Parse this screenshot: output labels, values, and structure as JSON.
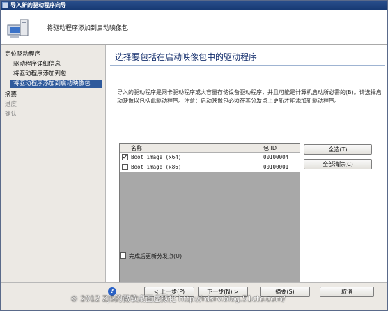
{
  "window": {
    "title": "导入新的驱动程序向导"
  },
  "header": {
    "subtitle": "将驱动程序添加到启动映像包"
  },
  "sidebar": {
    "items": [
      {
        "label": "定位驱动程序"
      },
      {
        "label": "驱动程序详细信息"
      },
      {
        "label": "将驱动程序添加到包"
      },
      {
        "label": "将驱动程序添加到启动映像包"
      },
      {
        "label": "摘要"
      },
      {
        "label": "进度"
      },
      {
        "label": "确认"
      }
    ]
  },
  "main": {
    "title": "选择要包括在启动映像包中的驱动程序",
    "description": "导入的驱动程序是网卡驱动程序或大容量存储设备驱动程序，并且可能是计算机启动所必需的(B)。请选择启动映像以包括此驱动程序。注意：启动映像包必须在其分发点上更新才能添加新驱动程序。"
  },
  "grid": {
    "columns": {
      "name": "名称",
      "package_id": "包 ID"
    },
    "rows": [
      {
        "checked": true,
        "check_glyph": "✔",
        "name": "Boot image (x64)",
        "package_id": "00100004"
      },
      {
        "checked": false,
        "check_glyph": "",
        "name": "Boot image (x86)",
        "package_id": "00100001"
      }
    ]
  },
  "buttons": {
    "select_all": "全选(T)",
    "clear_all": "全部清除(C)",
    "prev": "< 上一步(P)",
    "next": "下一步(N) >",
    "summary": "摘要(S)",
    "cancel": "取消"
  },
  "options": {
    "update_dp": "完成后更新分发点(U)"
  },
  "watermark": "© 2012 ZJS的微软桌面虚拟化 http://rdsrv.blog.51cto.com/",
  "colors": {
    "titlebar": "#1f4584",
    "selected": "#2f5a9c",
    "heading": "#16306e"
  }
}
